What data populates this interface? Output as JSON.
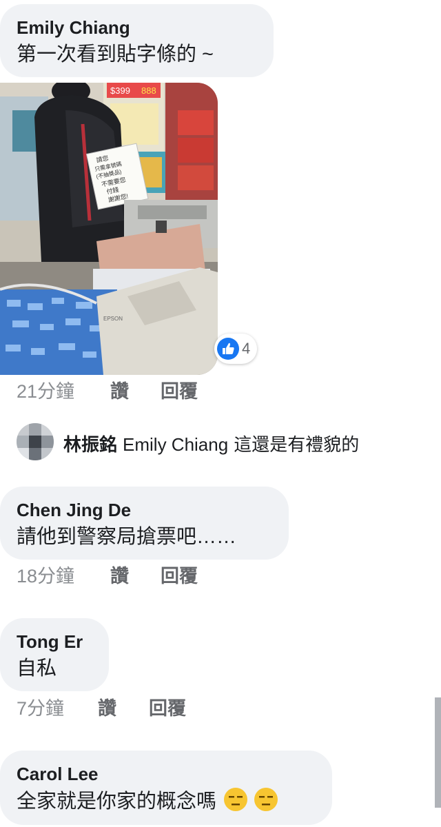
{
  "comments": [
    {
      "author": "Emily Chiang",
      "text": "第一次看到貼字條的 ~",
      "time": "21分鐘",
      "like": "讚",
      "reply": "回覆",
      "reaction_count": "4"
    },
    {
      "author": "Chen Jing De",
      "text": "請他到警察局搶票吧……",
      "time": "18分鐘",
      "like": "讚",
      "reply": "回覆"
    },
    {
      "author": "Tong Er",
      "text": "自私",
      "time": "7分鐘",
      "like": "讚",
      "reply": "回覆"
    },
    {
      "author": "Carol Lee",
      "text": "全家就是你家的概念嗎"
    }
  ],
  "reply": {
    "author": "林振銘",
    "mention": "Emily Chiang",
    "text": "這還是有禮貌的"
  },
  "photo": {
    "note_text": [
      "請您",
      "只需拿號碼",
      "(不抽獎品)",
      "不需要您",
      "付錢",
      "謝謝您!"
    ],
    "printer_brand": "EPSON",
    "banner_price": "$399",
    "banner_price2": "888"
  },
  "icons": {
    "like": "thumbs-up-icon",
    "emoji": "expressionless-face-icon"
  },
  "colors": {
    "bubble": "#f0f2f5",
    "like_blue": "#1877f2",
    "meta_gray": "#8a8d91"
  }
}
